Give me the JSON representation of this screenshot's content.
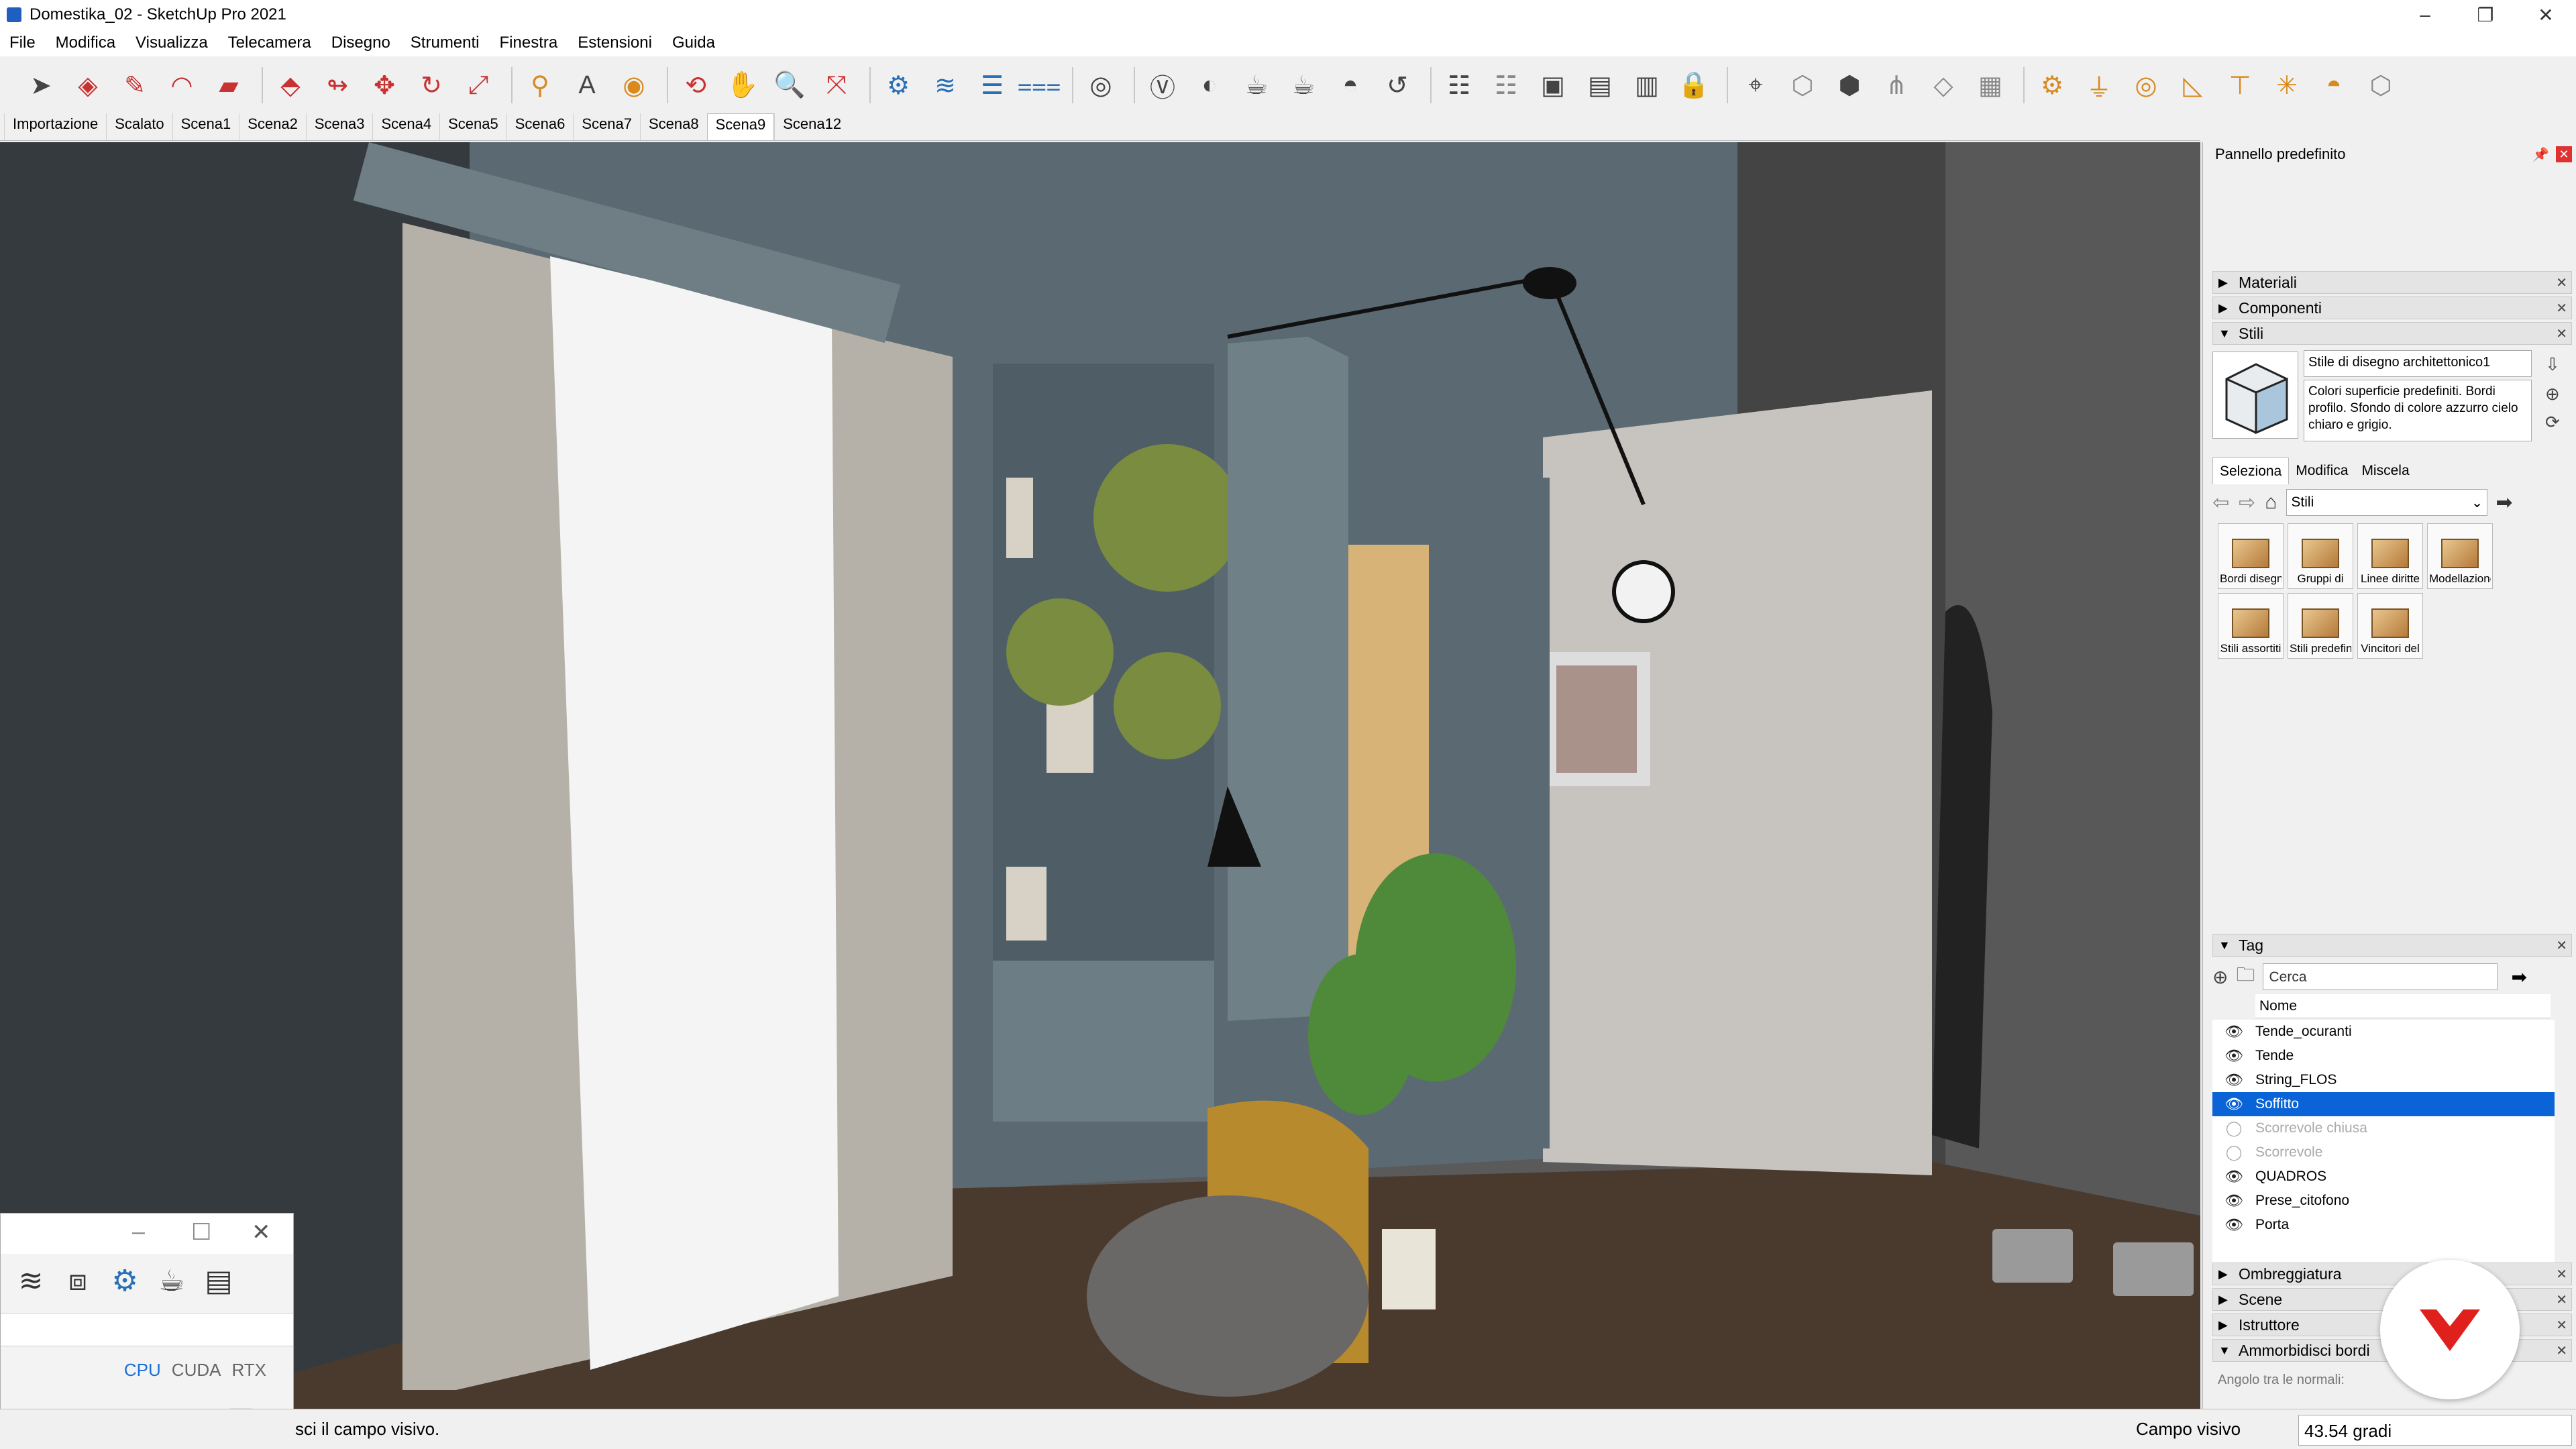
{
  "window": {
    "title": "Domestika_02 - SketchUp Pro 2021"
  },
  "menu": [
    "File",
    "Modifica",
    "Visualizza",
    "Telecamera",
    "Disegno",
    "Strumenti",
    "Finestra",
    "Estensioni",
    "Guida"
  ],
  "scenes": {
    "tabs": [
      "Importazione",
      "Scalato",
      "Scena1",
      "Scena2",
      "Scena3",
      "Scena4",
      "Scena5",
      "Scena6",
      "Scena7",
      "Scena8",
      "Scena9",
      "Scena12"
    ],
    "active": "Scena9"
  },
  "tray": {
    "title": "Pannello predefinito",
    "sections": {
      "materiali": "Materiali",
      "componenti": "Componenti",
      "stili": "Stili",
      "tag": "Tag",
      "ombreggiatura": "Ombreggiatura",
      "scene": "Scene",
      "istruttore": "Istruttore",
      "ammorbidisci": "Ammorbidisci bordi"
    },
    "styles": {
      "current_name": "Stile di disegno architettonico1",
      "description": "Colori superficie predefiniti. Bordi profilo. Sfondo di colore azzurro cielo chiaro e grigio.",
      "subtabs": [
        "Seleziona",
        "Modifica",
        "Miscela"
      ],
      "collection": "Stili",
      "tiles": [
        "Bordi disegnati",
        "Gruppi di",
        "Linee diritte",
        "Modellazione",
        "Stili assortiti",
        "Stili predefiniti",
        "Vincitori del"
      ]
    },
    "tags": {
      "search_placeholder": "Cerca",
      "column_name": "Nome",
      "items": [
        {
          "name": "Tende_ocuranti",
          "visible": true
        },
        {
          "name": "Tende",
          "visible": true
        },
        {
          "name": "String_FLOS",
          "visible": true
        },
        {
          "name": "Soffitto",
          "visible": true,
          "selected": true
        },
        {
          "name": "Scorrevole chiusa",
          "visible": false
        },
        {
          "name": "Scorrevole",
          "visible": false
        },
        {
          "name": "QUADROS",
          "visible": true
        },
        {
          "name": "Prese_citofono",
          "visible": true
        },
        {
          "name": "Porta",
          "visible": true
        }
      ]
    },
    "soften_edges": {
      "label": "Angolo tra le normali:"
    }
  },
  "float_panel": {
    "modes": [
      "CPU",
      "CUDA",
      "RTX"
    ],
    "active_mode": "CPU"
  },
  "status": {
    "message": "sci il campo visivo.",
    "value_label": "Campo visivo",
    "value": "43.54 gradi"
  },
  "colors": {
    "selection": "#0a64d8",
    "logo": "#e0201c",
    "close": "#e03030"
  }
}
